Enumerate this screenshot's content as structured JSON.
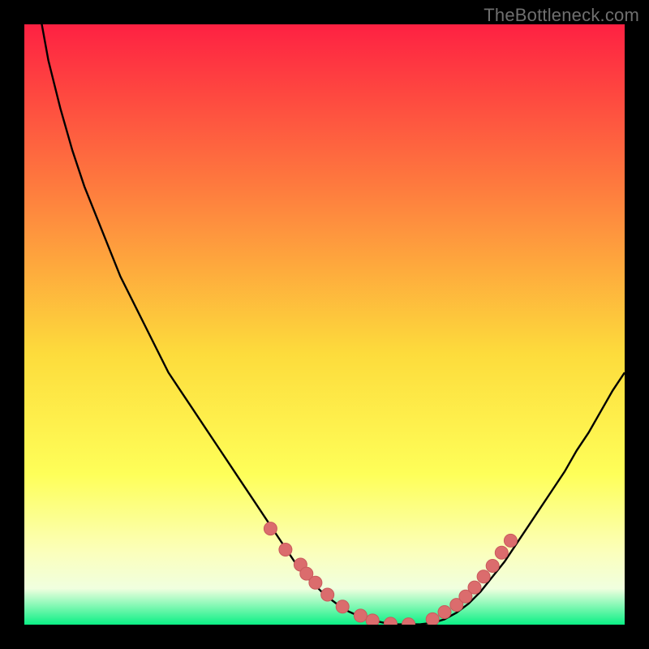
{
  "watermark": "TheBottleneck.com",
  "colors": {
    "gradient_top": "#fe2142",
    "gradient_mid1": "#fe7e3e",
    "gradient_mid2": "#fddc3c",
    "gradient_mid3": "#feff59",
    "gradient_mid4": "#fbffbc",
    "gradient_bottom_band": "#f0ffdf",
    "gradient_bottom": "#0bf085",
    "curve": "#000000",
    "marker_fill": "#db6c6d",
    "marker_stroke": "#c95a5c"
  },
  "chart_data": {
    "type": "line",
    "title": "",
    "xlabel": "",
    "ylabel": "",
    "xlim": [
      0,
      100
    ],
    "ylim": [
      0,
      100
    ],
    "x": [
      0,
      2,
      4,
      6,
      8,
      10,
      12,
      14,
      16,
      18,
      20,
      22,
      24,
      26,
      28,
      30,
      32,
      34,
      36,
      38,
      40,
      42,
      44,
      46,
      48,
      50,
      52,
      54,
      56,
      58,
      60,
      62,
      64,
      66,
      68,
      70,
      72,
      74,
      76,
      78,
      80,
      82,
      84,
      86,
      88,
      90,
      92,
      94,
      96,
      98,
      100
    ],
    "values": [
      120,
      105,
      94,
      86,
      79,
      73,
      68,
      63,
      58,
      54,
      50,
      46,
      42,
      39,
      36,
      33,
      30,
      27,
      24,
      21,
      18,
      15,
      12,
      9,
      7,
      5,
      3.5,
      2.2,
      1.3,
      0.7,
      0.3,
      0.08,
      0.03,
      0.08,
      0.3,
      0.9,
      2,
      3.5,
      5.5,
      8,
      10.5,
      13.5,
      16.5,
      19.5,
      22.5,
      25.5,
      29,
      32,
      35.5,
      39,
      42
    ],
    "markers_x": [
      41,
      43.5,
      46,
      47,
      48.5,
      50.5,
      53,
      56,
      58,
      61,
      64,
      68,
      70,
      72,
      73.5,
      75,
      76.5,
      78,
      79.5,
      81
    ],
    "markers_y": [
      16,
      12.5,
      10,
      8.5,
      7,
      5,
      3,
      1.5,
      0.7,
      0.15,
      0.05,
      0.9,
      2.1,
      3.3,
      4.7,
      6.2,
      8,
      9.8,
      12,
      14
    ],
    "note": "x and values are normalized 0–100 (x: horizontal position; values: bottleneck percentage, approx). Curve dips to ~0 around x≈62–64 and rises on both sides. Markers cluster along the lower portion of the curve."
  }
}
